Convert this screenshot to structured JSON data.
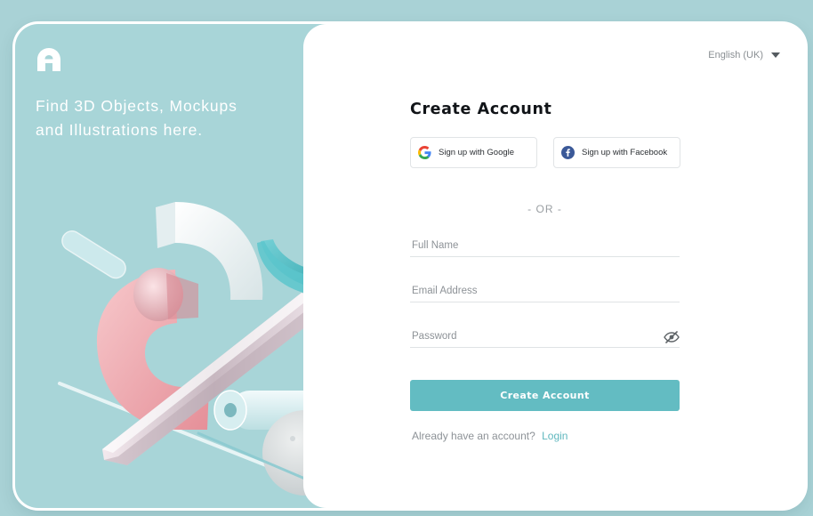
{
  "colors": {
    "background": "#a9d2d6",
    "left_panel": "#a8d5d8",
    "accent": "#63bcc2",
    "link": "#5fb7be"
  },
  "brand": {
    "logo_icon": "abstract-a-logo-icon"
  },
  "hero": {
    "tagline_line1": "Find 3D Objects, Mockups",
    "tagline_line2": "and Illustrations here.",
    "illustration": "3d-abstract-shapes-illustration"
  },
  "language": {
    "selected": "English (UK)",
    "icon": "caret-down-icon"
  },
  "form": {
    "title": "Create Account",
    "google_button": "Sign up with Google",
    "facebook_button": "Sign up with Facebook",
    "separator": "- OR -",
    "full_name_placeholder": "Full Name",
    "email_placeholder": "Email Address",
    "password_placeholder": "Password",
    "password_toggle_icon": "eye-slash-icon",
    "submit_label": "Create Account",
    "login_prompt": "Already have an account?",
    "login_link": "Login"
  }
}
